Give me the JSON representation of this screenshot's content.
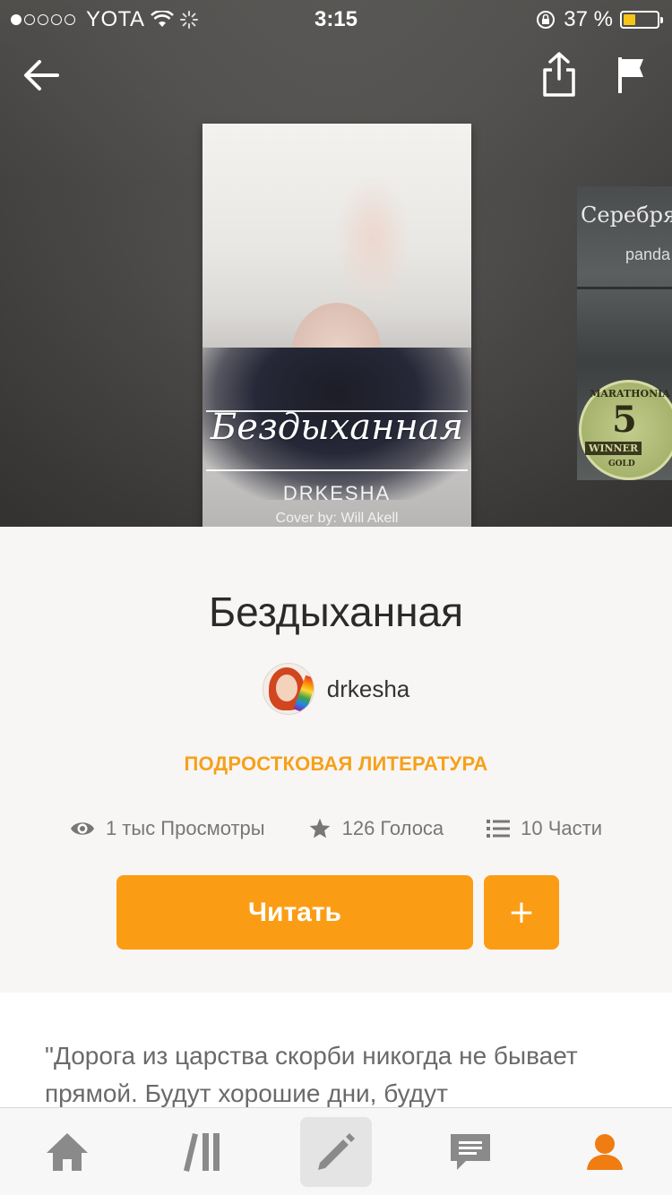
{
  "status_bar": {
    "carrier": "YOTA",
    "time": "3:15",
    "battery_percent": "37 %",
    "battery_level": 0.37,
    "signal_bars_filled": 1
  },
  "nav": {
    "back_icon": "arrow-left-icon",
    "share_icon": "share-icon",
    "report_icon": "flag-icon"
  },
  "cover": {
    "title": "Бездыханная",
    "author": "DRKESHA",
    "credit": "Cover by: Will Akell"
  },
  "next_cover": {
    "title": "Серебрян",
    "subtitle": "panda",
    "badge_top": "MARATHONIA",
    "badge_number": "5",
    "badge_winner": "WINNER",
    "badge_gold": "GOLD"
  },
  "book": {
    "title": "Бездыханная",
    "author": "drkesha",
    "genre": "ПОДРОСТКОВАЯ ЛИТЕРАТУРА"
  },
  "stats": {
    "views": "1 тыс Просмотры",
    "votes": "126 Голоса",
    "parts": "10 Части"
  },
  "actions": {
    "read_label": "Читать",
    "add_label": "+"
  },
  "description": "\"Дорога из царства скорби никогда не бывает прямой. Будут хорошие дни, будут",
  "tab_bar": [
    {
      "name": "home",
      "icon": "home-icon"
    },
    {
      "name": "library",
      "icon": "library-icon"
    },
    {
      "name": "write",
      "icon": "pencil-icon",
      "active": true
    },
    {
      "name": "messages",
      "icon": "chat-icon"
    },
    {
      "name": "profile",
      "icon": "profile-icon"
    }
  ],
  "colors": {
    "accent": "#fb9d14",
    "genre": "#f5a11b",
    "tab_profile": "#f07c12"
  }
}
